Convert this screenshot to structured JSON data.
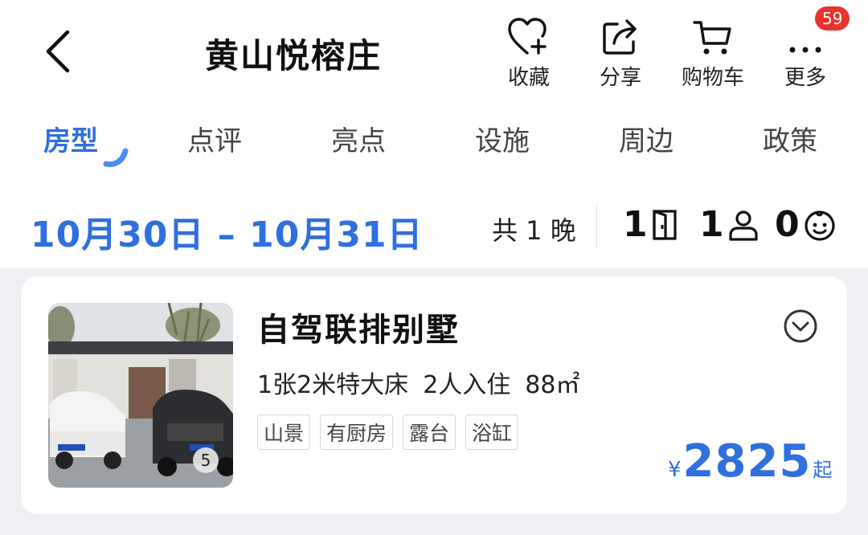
{
  "header": {
    "title": "黄山悦榕庄",
    "actions": [
      {
        "label": "收藏",
        "icon": "heart-plus-icon"
      },
      {
        "label": "分享",
        "icon": "share-icon"
      },
      {
        "label": "购物车",
        "icon": "cart-icon"
      },
      {
        "label": "更多",
        "icon": "more-icon"
      }
    ],
    "badge_count": "59"
  },
  "tabs": [
    {
      "label": "房型",
      "active": true
    },
    {
      "label": "点评"
    },
    {
      "label": "亮点"
    },
    {
      "label": "设施"
    },
    {
      "label": "周边"
    },
    {
      "label": "政策"
    }
  ],
  "booking": {
    "dates": "10月30日 – 10月31日",
    "nights": "共 1 晚",
    "rooms": "1",
    "adults": "1",
    "children": "0"
  },
  "room": {
    "name": "自驾联排别墅",
    "bed": "1张2米特大床",
    "occupancy": "2人入住",
    "area": "88㎡",
    "tags": [
      "山景",
      "有厨房",
      "露台",
      "浴缸"
    ],
    "photo_count": "5",
    "price_currency": "¥",
    "price": "2825",
    "price_suffix": "起"
  },
  "colors": {
    "accent": "#2f6fde",
    "badge": "#e8342b",
    "list_bg": "#eef0f4"
  }
}
